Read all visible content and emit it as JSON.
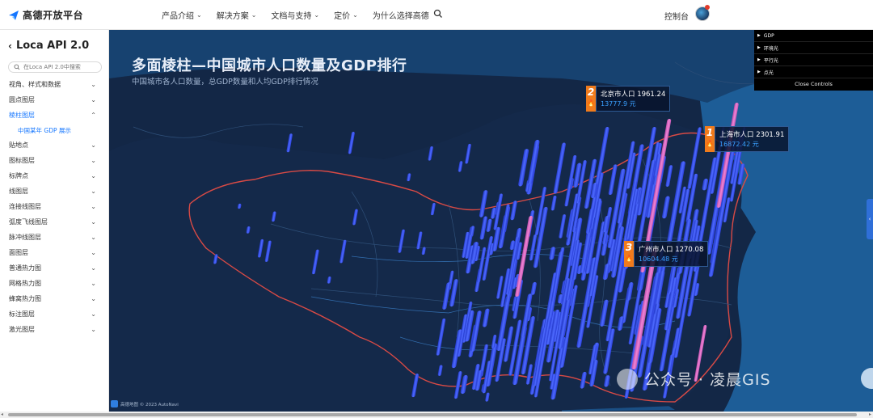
{
  "header": {
    "brand": "高德开放平台",
    "nav": [
      "产品介绍",
      "解决方案",
      "文档与支持",
      "定价",
      "为什么选择高德"
    ],
    "console": "控制台"
  },
  "sidebar": {
    "title": "Loca API 2.0",
    "search_placeholder": "在Loca API 2.0中搜索",
    "items": [
      {
        "label": "视角、样式和数据",
        "state": "collapsed"
      },
      {
        "label": "圆点图层",
        "state": "collapsed"
      },
      {
        "label": "棱柱图层",
        "state": "expanded"
      },
      {
        "label": "贴地点",
        "state": "collapsed"
      },
      {
        "label": "图标图层",
        "state": "collapsed"
      },
      {
        "label": "标牌点",
        "state": "collapsed"
      },
      {
        "label": "线图层",
        "state": "collapsed"
      },
      {
        "label": "连接线图层",
        "state": "collapsed"
      },
      {
        "label": "弧度飞线图层",
        "state": "collapsed"
      },
      {
        "label": "脉冲线图层",
        "state": "collapsed"
      },
      {
        "label": "面图层",
        "state": "collapsed"
      },
      {
        "label": "普通热力图",
        "state": "collapsed"
      },
      {
        "label": "网格热力图",
        "state": "collapsed"
      },
      {
        "label": "蜂窝热力图",
        "state": "collapsed"
      },
      {
        "label": "标注图层",
        "state": "collapsed"
      },
      {
        "label": "激光图层",
        "state": "collapsed"
      }
    ],
    "active_subitem": "中国某年 GDP 展示"
  },
  "map": {
    "title": "多面棱柱—中国城市人口数量及GDP排行",
    "subtitle": "中国城市各人口数量，总GDP数量和人均GDP排行情况",
    "controls": {
      "items": [
        "GDP",
        "环境光",
        "平行光",
        "点光"
      ],
      "close_label": "Close Controls"
    },
    "rankings": [
      {
        "rank": "1",
        "city": "上海市人口 2301.91",
        "gdp": "16872.42 元"
      },
      {
        "rank": "2",
        "city": "北京市人口 1961.24",
        "gdp": "13777.9 元"
      },
      {
        "rank": "3",
        "city": "广州市人口 1270.08",
        "gdp": "10604.48 元"
      }
    ],
    "attribution": "高德地图 © 2023 AutoNavi",
    "watermark": "公众号 · 凌晨GIS",
    "colors": {
      "land": "#132746",
      "sea": "#1b5a94",
      "prism": "#3c5bff",
      "highlight_prism": "#e86cc4",
      "border": "#e0544a",
      "rank_badge": "#f07b1c"
    }
  }
}
